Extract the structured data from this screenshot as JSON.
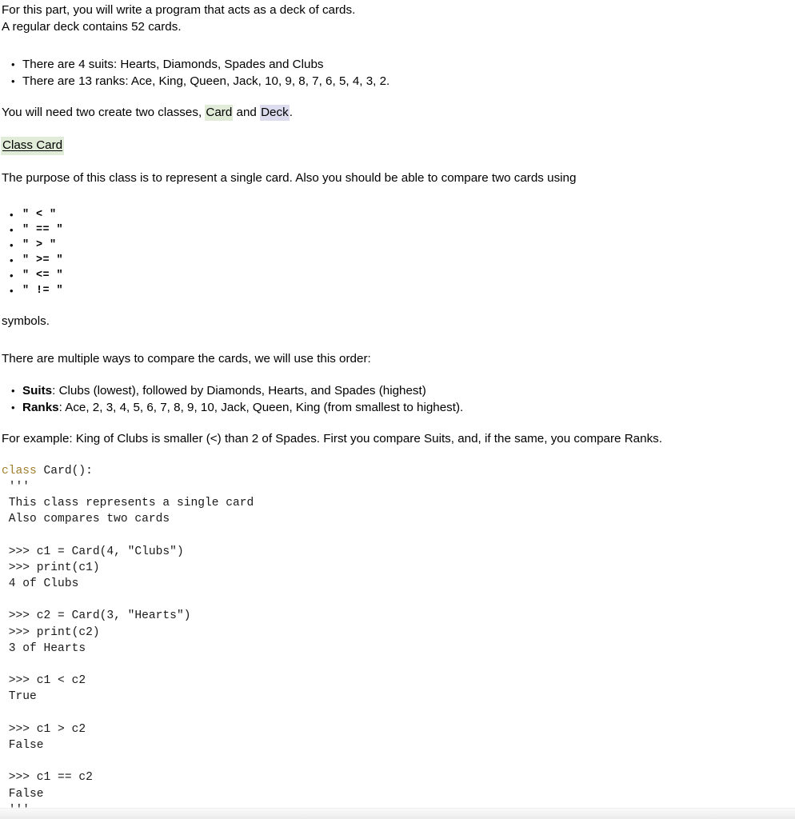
{
  "intro": {
    "line1": "For this part, you will write a program that acts as a deck of cards.",
    "line2": "A regular deck contains 52 cards."
  },
  "deck_facts": [
    "There are 4 suits: Hearts, Diamonds, Spades and Clubs",
    "There are 13 ranks: Ace, King, Queen, Jack, 10, 9, 8, 7, 6, 5, 4, 3, 2."
  ],
  "classes_sentence": {
    "before": "You will need two create two classes, ",
    "card_term": "Card",
    "middle": " and ",
    "deck_term": "Deck",
    "after": "."
  },
  "class_card_heading": "Class Card",
  "purpose_text": "The purpose of this class is to represent a single card. Also you should be able to compare two cards using",
  "operators": [
    "\" < \"",
    "\" == \"",
    "\" > \"",
    "\" >= \"",
    "\" <= \"",
    "\" != \""
  ],
  "symbols_word": "symbols.",
  "order_intro": "There are multiple ways to compare the cards, we will use this order:",
  "order_rules": [
    {
      "label": "Suits",
      "text": ": Clubs (lowest), followed by Diamonds, Hearts, and Spades (highest)"
    },
    {
      "label": "Ranks",
      "text": ": Ace, 2, 3, 4, 5, 6, 7, 8, 9, 10, Jack, Queen, King  (from smallest to highest)."
    }
  ],
  "example_text": "For example: King of Clubs is smaller (<) than 2 of Spades. First you compare Suits, and, if the same, you compare Ranks.",
  "code": {
    "keyword": "class",
    "after_keyword": " Card():",
    "body": " '''\n This class represents a single card\n Also compares two cards\n\n >>> c1 = Card(4, \"Clubs\")\n >>> print(c1)\n 4 of Clubs\n\n >>> c2 = Card(3, \"Hearts\")\n >>> print(c2)\n 3 of Hearts\n\n >>> c1 < c2\n True\n\n >>> c1 > c2\n False\n\n >>> c1 == c2\n False\n '''"
  },
  "colors": {
    "card_highlight": "#e1ecd8",
    "deck_highlight": "#dcdcee",
    "keyword": "#a08030",
    "text": "#000000",
    "background": "#ffffff"
  }
}
